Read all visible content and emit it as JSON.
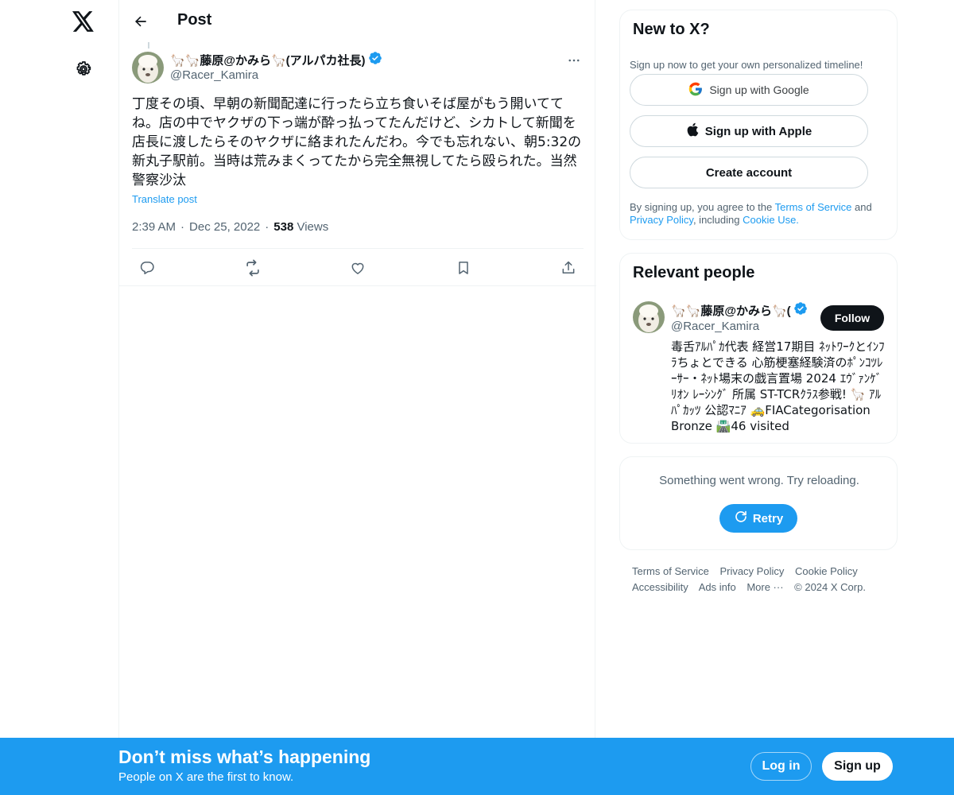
{
  "nav": {
    "logo_icon": "x-logo-icon",
    "settings_icon": "gear-icon"
  },
  "header": {
    "title": "Post",
    "back_icon": "arrow-left-icon"
  },
  "post": {
    "display_name": "🦙🦙藤原@かみら🦙(アルパカ社長)",
    "handle": "@Racer_Kamira",
    "verified": true,
    "text": "丁度その頃、早朝の新聞配達に行ったら立ち食いそば屋がもう開いててね。店の中でヤクザの下っ端が酔っ払ってたんだけど、シカトして新聞を店長に渡したらそのヤクザに絡まれたんだわ。今でも忘れない、朝5:32の新丸子駅前。当時は荒みまくってたから完全無視してたら殴られた。当然警察沙汰",
    "translate_label": "Translate post",
    "time": "2:39 AM",
    "date": "Dec 25, 2022",
    "views_count": "538",
    "views_label": "Views",
    "actions": [
      "reply-icon",
      "repost-icon",
      "like-icon",
      "bookmark-icon",
      "share-icon"
    ]
  },
  "signup_card": {
    "title": "New to X?",
    "subtitle": "Sign up now to get your own personalized timeline!",
    "google_label": "Sign up with Google",
    "apple_label": "Sign up with Apple",
    "create_label": "Create account",
    "legal_prefix": "By signing up, you agree to the ",
    "terms_link": "Terms of Service",
    "legal_and": " and ",
    "privacy_link": "Privacy Policy",
    "legal_including": ", including ",
    "cookie_link": "Cookie Use."
  },
  "relevant_people": {
    "title": "Relevant people",
    "name": "🦙🦙藤原@かみら🦙(",
    "handle": "@Racer_Kamira",
    "follow_label": "Follow",
    "bio": "毒舌ｱﾙﾊﾟｶ代表 経営17期目 ﾈｯﾄﾜｰｸとｲﾝﾌﾗちょとできる 心筋梗塞経験済のﾎﾟﾝｺﾂﾚｰｻｰ・ﾈｯﾄ場末の戯言置場 2024 ｴｳﾞｧﾝｹﾞﾘｵﾝ ﾚｰｼﾝｸﾞ 所属 ST-TCRｸﾗｽ参戦! 🦙 ｱﾙﾊﾟｶｯﾂ 公認ﾏﾆｱ 🚕FIACategorisation Bronze 🛣️46 visited"
  },
  "error_card": {
    "message": "Something went wrong. Try reloading.",
    "retry_label": "Retry"
  },
  "footer": {
    "links": [
      "Terms of Service",
      "Privacy Policy",
      "Cookie Policy",
      "Accessibility",
      "Ads info",
      "More ···",
      "© 2024 X Corp."
    ]
  },
  "bottom_bar": {
    "title": "Don’t miss what’s happening",
    "subtitle": "People on X are the first to know.",
    "login_label": "Log in",
    "signup_label": "Sign up"
  },
  "colors": {
    "accent": "#1d9bf0",
    "text": "#0f1419",
    "muted": "#536471",
    "border": "#eff3f4"
  }
}
